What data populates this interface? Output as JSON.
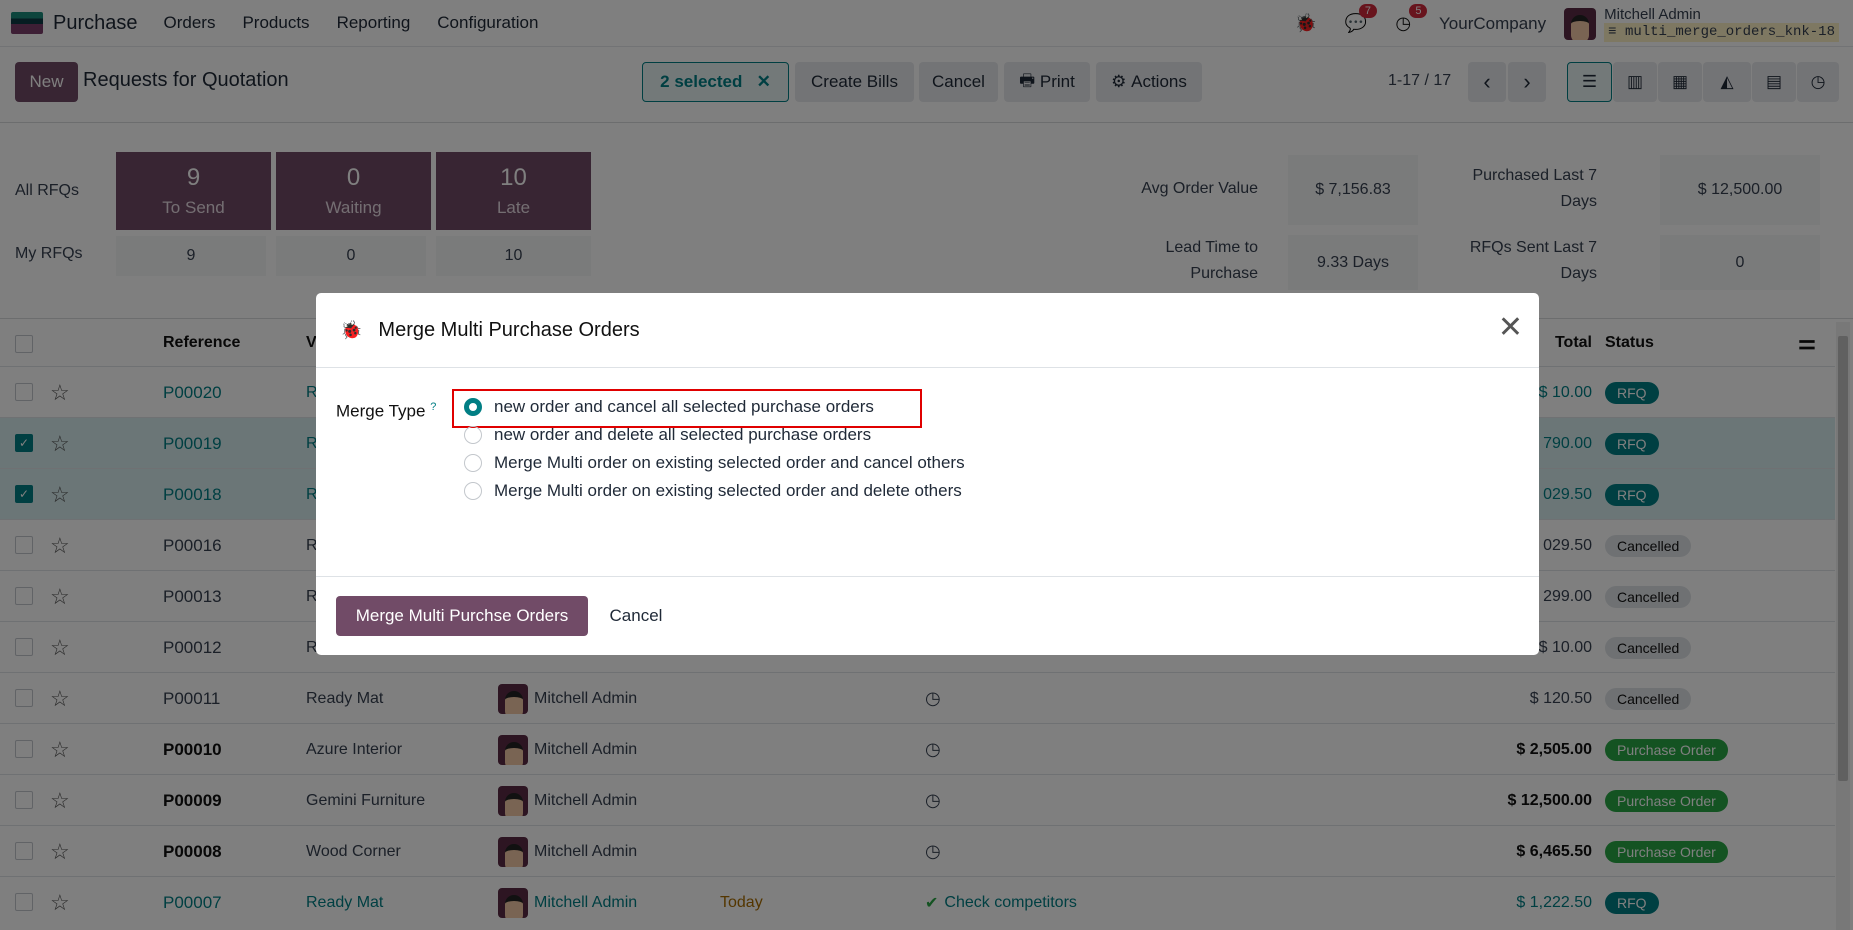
{
  "nav": {
    "app": "Purchase",
    "menus": [
      "Orders",
      "Products",
      "Reporting",
      "Configuration"
    ],
    "messages_count": "7",
    "activities_count": "5",
    "company": "YourCompany",
    "user": "Mitchell Admin",
    "database": "multi_merge_orders_knk-18"
  },
  "control": {
    "new": "New",
    "title": "Requests for Quotation",
    "selected": "2 selected",
    "create_bills": "Create Bills",
    "cancel": "Cancel",
    "print": "Print",
    "actions": "Actions",
    "pager": "1-17 / 17"
  },
  "stats": {
    "all_label": "All RFQs",
    "my_label": "My RFQs",
    "cards": [
      {
        "n": "9",
        "l": "To Send",
        "my": "9"
      },
      {
        "n": "0",
        "l": "Waiting",
        "my": "0"
      },
      {
        "n": "10",
        "l": "Late",
        "my": "10"
      }
    ],
    "avg_label": "Avg Order Value",
    "avg": "$ 7,156.83",
    "lead_label1": "Lead Time to",
    "lead_label2": "Purchase",
    "lead": "9.33 Days",
    "purch_label1": "Purchased Last 7",
    "purch_label2": "Days",
    "purch": "$ 12,500.00",
    "sent_label1": "RFQs Sent Last 7",
    "sent_label2": "Days",
    "sent": "0"
  },
  "table": {
    "headers": {
      "reference": "Reference",
      "vendor": "V",
      "total": "Total",
      "status": "Status"
    },
    "rows": [
      {
        "ref": "P00020",
        "vendor": "R",
        "buyer": "",
        "date": "",
        "activity": "",
        "total": "$ 10.00",
        "status": "RFQ",
        "kind": "rfq",
        "sel": false,
        "style": "link"
      },
      {
        "ref": "P00019",
        "vendor": "R",
        "buyer": "",
        "date": "",
        "activity": "",
        "total": "790.00",
        "status": "RFQ",
        "kind": "rfq",
        "sel": true,
        "style": "link"
      },
      {
        "ref": "P00018",
        "vendor": "R",
        "buyer": "",
        "date": "",
        "activity": "",
        "total": "029.50",
        "status": "RFQ",
        "kind": "rfq",
        "sel": true,
        "style": "link"
      },
      {
        "ref": "P00016",
        "vendor": "R",
        "buyer": "",
        "date": "",
        "activity": "",
        "total": "029.50",
        "status": "Cancelled",
        "kind": "can",
        "sel": false,
        "style": "muted"
      },
      {
        "ref": "P00013",
        "vendor": "R",
        "buyer": "",
        "date": "",
        "activity": "",
        "total": "299.00",
        "status": "Cancelled",
        "kind": "can",
        "sel": false,
        "style": "muted"
      },
      {
        "ref": "P00012",
        "vendor": "R",
        "buyer": "",
        "date": "",
        "activity": "",
        "total": "$ 10.00",
        "status": "Cancelled",
        "kind": "can",
        "sel": false,
        "style": "muted"
      },
      {
        "ref": "P00011",
        "vendor": "Ready Mat",
        "buyer": "Mitchell Admin",
        "date": "",
        "activity": "",
        "total": "$ 120.50",
        "status": "Cancelled",
        "kind": "can",
        "sel": false,
        "style": "muted"
      },
      {
        "ref": "P00010",
        "vendor": "Azure Interior",
        "buyer": "Mitchell Admin",
        "date": "",
        "activity": "",
        "total": "$ 2,505.00",
        "status": "Purchase Order",
        "kind": "po",
        "sel": false,
        "style": "bold"
      },
      {
        "ref": "P00009",
        "vendor": "Gemini Furniture",
        "buyer": "Mitchell Admin",
        "date": "",
        "activity": "",
        "total": "$ 12,500.00",
        "status": "Purchase Order",
        "kind": "po",
        "sel": false,
        "style": "bold"
      },
      {
        "ref": "P00008",
        "vendor": "Wood Corner",
        "buyer": "Mitchell Admin",
        "date": "",
        "activity": "",
        "total": "$ 6,465.50",
        "status": "Purchase Order",
        "kind": "po",
        "sel": false,
        "style": "bold"
      },
      {
        "ref": "P00007",
        "vendor": "Ready Mat",
        "buyer": "Mitchell Admin",
        "date": "Today",
        "activity": "Check competitors",
        "total": "$ 1,222.50",
        "status": "RFQ",
        "kind": "rfq",
        "sel": false,
        "style": "link"
      }
    ]
  },
  "modal": {
    "title": "Merge Multi Purchase Orders",
    "field_label": "Merge Type",
    "help": "?",
    "options": [
      "new order and cancel all selected purchase orders",
      "new order and delete all selected purchase orders",
      "Merge Multi order on existing selected order and cancel others",
      "Merge Multi order on existing selected order and delete others"
    ],
    "selected_option": 0,
    "confirm": "Merge Multi Purchse Orders",
    "cancel": "Cancel"
  },
  "colors": {
    "brand": "#714b67",
    "accent": "#017e84",
    "highlight": "#e00000"
  }
}
